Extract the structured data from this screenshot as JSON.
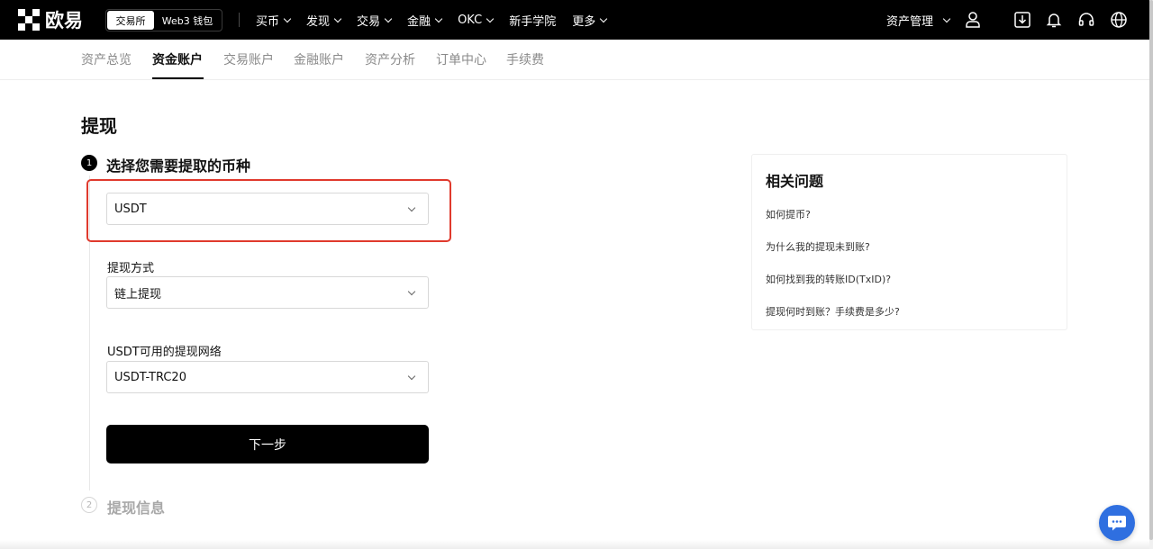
{
  "brand": {
    "name": "欧易"
  },
  "mode_toggle": {
    "exchange": "交易所",
    "web3": "Web3 钱包"
  },
  "top_nav": [
    {
      "label": "买币",
      "dropdown": true
    },
    {
      "label": "发现",
      "dropdown": true
    },
    {
      "label": "交易",
      "dropdown": true
    },
    {
      "label": "金融",
      "dropdown": true
    },
    {
      "label": "OKC",
      "dropdown": true
    },
    {
      "label": "新手学院",
      "dropdown": false
    },
    {
      "label": "更多",
      "dropdown": true
    }
  ],
  "top_right": {
    "asset_management": "资产管理",
    "icons": [
      "user-icon",
      "download-icon",
      "bell-icon",
      "headset-icon",
      "globe-icon"
    ]
  },
  "sub_nav": [
    {
      "label": "资产总览",
      "active": false
    },
    {
      "label": "资金账户",
      "active": true
    },
    {
      "label": "交易账户",
      "active": false
    },
    {
      "label": "金融账户",
      "active": false
    },
    {
      "label": "资产分析",
      "active": false
    },
    {
      "label": "订单中心",
      "active": false
    },
    {
      "label": "手续费",
      "active": false
    }
  ],
  "page": {
    "title": "提现",
    "step1": {
      "number": "1",
      "title": "选择您需要提取的币种"
    },
    "step2": {
      "number": "2",
      "title": "提现信息"
    },
    "coin_select": {
      "value": "USDT"
    },
    "method": {
      "label": "提现方式",
      "value": "链上提现"
    },
    "network": {
      "label": "USDT可用的提现网络",
      "value": "USDT-TRC20"
    },
    "next_button": "下一步"
  },
  "faq": {
    "title": "相关问题",
    "items": [
      "如何提币?",
      "为什么我的提现未到账?",
      "如何找到我的转账ID(TxID)?",
      "提现何时到账？手续费是多少?"
    ]
  },
  "colors": {
    "topbar": "#000000",
    "highlight": "#e03a2d",
    "primary_button": "#000000",
    "chat": "#2f6fe0"
  }
}
